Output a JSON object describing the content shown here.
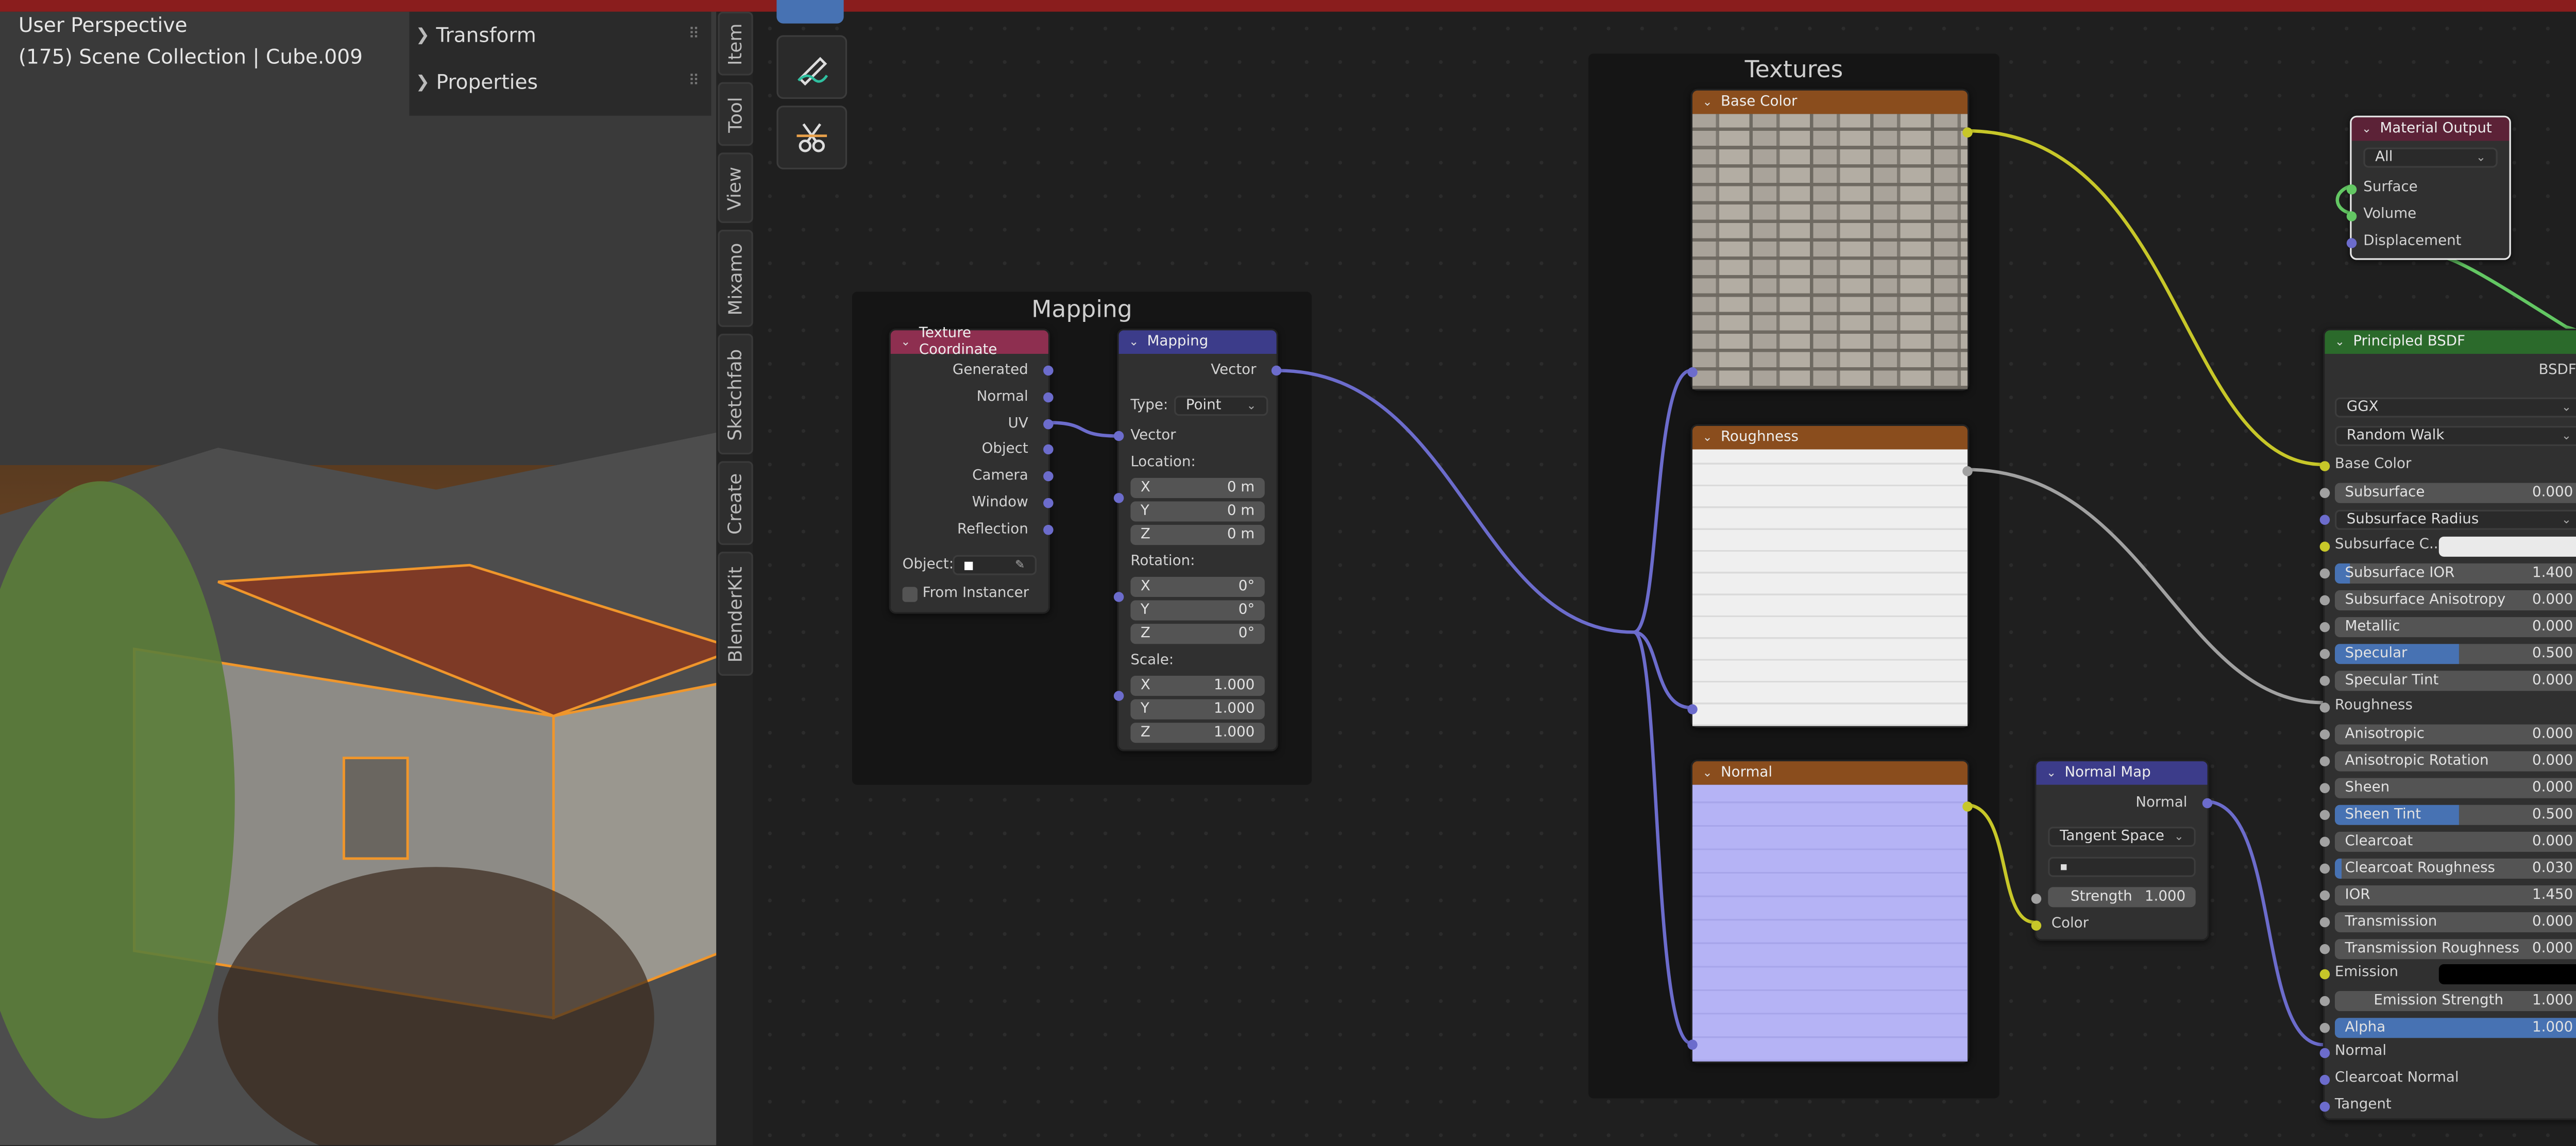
{
  "viewport": {
    "perspective": "User Perspective",
    "collection": "(175) Scene Collection | Cube.009"
  },
  "npanel": {
    "sections": [
      "Transform",
      "Properties"
    ]
  },
  "sidebar_tabs": [
    "Item",
    "Tool",
    "View",
    "Mixamo",
    "Sketchfab",
    "Create",
    "BlenderKit"
  ],
  "frames": {
    "mapping": "Mapping",
    "textures": "Textures"
  },
  "texture_coordinate": {
    "title": "Texture Coordinate",
    "outputs": [
      "Generated",
      "Normal",
      "UV",
      "Object",
      "Camera",
      "Window",
      "Reflection"
    ],
    "object_label": "Object:",
    "from_instancer": "From Instancer"
  },
  "mapping": {
    "title": "Mapping",
    "out_vector": "Vector",
    "type_label": "Type:",
    "type_value": "Point",
    "in_vector": "Vector",
    "location_label": "Location:",
    "location": [
      [
        "X",
        "0 m"
      ],
      [
        "Y",
        "0 m"
      ],
      [
        "Z",
        "0 m"
      ]
    ],
    "rotation_label": "Rotation:",
    "rotation": [
      [
        "X",
        "0°"
      ],
      [
        "Y",
        "0°"
      ],
      [
        "Z",
        "0°"
      ]
    ],
    "scale_label": "Scale:",
    "scale": [
      [
        "X",
        "1.000"
      ],
      [
        "Y",
        "1.000"
      ],
      [
        "Z",
        "1.000"
      ]
    ]
  },
  "textures": {
    "base_color": "Base Color",
    "roughness": "Roughness",
    "normal": "Normal"
  },
  "normal_map": {
    "title": "Normal Map",
    "output": "Normal",
    "space": "Tangent Space",
    "strength_label": "Strength",
    "strength_value": "1.000",
    "color": "Color"
  },
  "material_output": {
    "title": "Material Output",
    "target": "All",
    "inputs": [
      "Surface",
      "Volume",
      "Displacement"
    ]
  },
  "bsdf": {
    "title": "Principled BSDF",
    "output": "BSDF",
    "distribution": "GGX",
    "subsurface_method": "Random Walk",
    "base_color": "Base Color",
    "subsurface": {
      "label": "Subsurface",
      "value": "0.000"
    },
    "subsurface_radius": "Subsurface Radius",
    "subsurface_color": "Subsurface C...",
    "subsurface_ior": {
      "label": "Subsurface IOR",
      "value": "1.400"
    },
    "subsurface_anisotropy": {
      "label": "Subsurface Anisotropy",
      "value": "0.000"
    },
    "metallic": {
      "label": "Metallic",
      "value": "0.000"
    },
    "specular": {
      "label": "Specular",
      "value": "0.500"
    },
    "specular_tint": {
      "label": "Specular Tint",
      "value": "0.000"
    },
    "roughness": "Roughness",
    "anisotropic": {
      "label": "Anisotropic",
      "value": "0.000"
    },
    "anisotropic_rotation": {
      "label": "Anisotropic Rotation",
      "value": "0.000"
    },
    "sheen": {
      "label": "Sheen",
      "value": "0.000"
    },
    "sheen_tint": {
      "label": "Sheen Tint",
      "value": "0.500"
    },
    "clearcoat": {
      "label": "Clearcoat",
      "value": "0.000"
    },
    "clearcoat_roughness": {
      "label": "Clearcoat Roughness",
      "value": "0.030"
    },
    "ior": {
      "label": "IOR",
      "value": "1.450"
    },
    "transmission": {
      "label": "Transmission",
      "value": "0.000"
    },
    "transmission_roughness": {
      "label": "Transmission Roughness",
      "value": "0.000"
    },
    "emission": "Emission",
    "emission_strength": {
      "label": "Emission Strength",
      "value": "1.000"
    },
    "alpha": {
      "label": "Alpha",
      "value": "1.000"
    },
    "normal": "Normal",
    "clearcoat_normal": "Clearcoat Normal",
    "tangent": "Tangent"
  },
  "colors": {
    "accent": "#4772b3",
    "header_red": "#8e2f50",
    "header_blue": "#3c3c8a",
    "header_orange": "#8a4d1d",
    "header_green": "#2b6a2b",
    "wire_vector": "#6c6ccc",
    "wire_color": "#c7c729"
  }
}
